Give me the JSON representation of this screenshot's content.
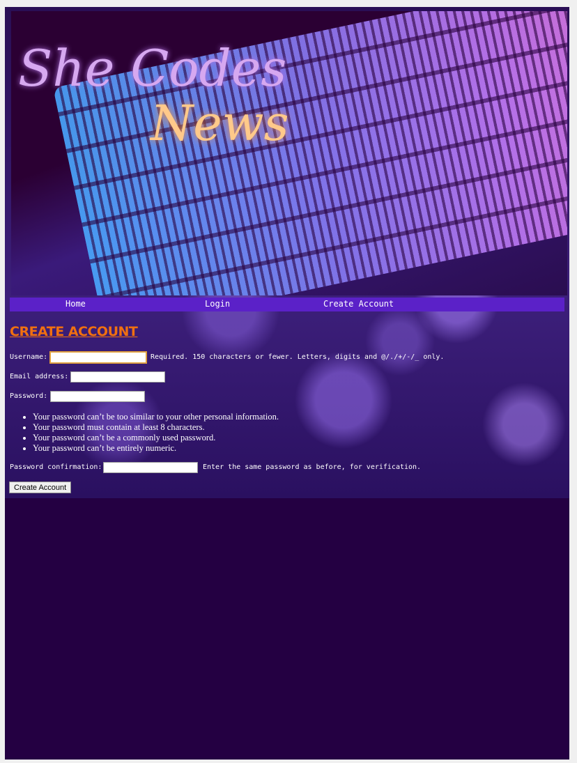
{
  "banner": {
    "logo_text": "She Codes News",
    "logo_line1": "She Codes",
    "logo_line2": "News"
  },
  "nav": {
    "items": [
      {
        "label": "Home"
      },
      {
        "label": "Login"
      },
      {
        "label": "Create Account"
      }
    ]
  },
  "page_title": "CREATE ACCOUNT",
  "form": {
    "username": {
      "label": "Username:",
      "value": "",
      "help": "Required. 150 characters or fewer. Letters, digits and @/./+/-/_ only."
    },
    "email": {
      "label": "Email address:",
      "value": ""
    },
    "password": {
      "label": "Password:",
      "value": ""
    },
    "password_rules": [
      "Your password can’t be too similar to your other personal information.",
      "Your password must contain at least 8 characters.",
      "Your password can’t be a commonly used password.",
      "Your password can’t be entirely numeric."
    ],
    "password_confirmation": {
      "label": "Password confirmation:",
      "value": "",
      "help": "Enter the same password as before, for verification."
    },
    "submit_label": "Create Account"
  },
  "colors": {
    "nav": "#5b21c8",
    "title": "#f07010",
    "page_bg": "#240042"
  }
}
